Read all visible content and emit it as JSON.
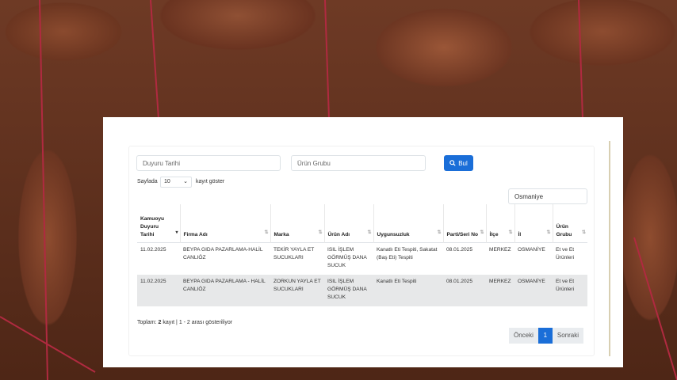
{
  "filters": {
    "announcement_date_placeholder": "Duyuru Tarihi",
    "product_group_placeholder": "Ürün Grubu",
    "search_button": "Bul",
    "page_size_prefix": "Sayfada",
    "page_size_value": "10",
    "page_size_suffix": "kayıt göster",
    "province_value": "Osmaniye"
  },
  "table": {
    "headers": [
      "Kamuoyu Duyuru Tarihi",
      "Firma Adı",
      "Marka",
      "Ürün Adı",
      "Uygunsuzluk",
      "Parti/Seri No",
      "İlçe",
      "İl",
      "Ürün Grubu"
    ],
    "rows": [
      [
        "11.02.2025",
        "BEYPA GIDA PAZARLAMA-HALİL CANLIÖZ",
        "TEKİR YAYLA ET SUCUKLARI",
        "ISIL İŞLEM GÖRMÜŞ DANA SUCUK",
        "Kanatlı Eti Tespiti, Sakatat (Baş Eti) Tespiti",
        "08.01.2025",
        "MERKEZ",
        "OSMANİYE",
        "Et ve Et Ürünleri"
      ],
      [
        "11.02.2025",
        "BEYPA GIDA PAZARLAMA - HALİL CANLIÖZ",
        "ZORKUN YAYLA ET SUCUKLARI",
        "ISIL İŞLEM GÖRMÜŞ DANA SUCUK",
        "Kanatlı Eti Tespiti",
        "08.01.2025",
        "MERKEZ",
        "OSMANİYE",
        "Et ve Et Ürünleri"
      ]
    ]
  },
  "footer": {
    "total_prefix": "Toplam:",
    "total_count": "2",
    "total_suffix": "kayıt | 1 - 2 arası gösteriliyor"
  },
  "pagination": {
    "prev": "Önceki",
    "current": "1",
    "next": "Sonraki"
  },
  "colors": {
    "accent": "#1a6ed8",
    "row_alt": "#e7e8e9"
  }
}
